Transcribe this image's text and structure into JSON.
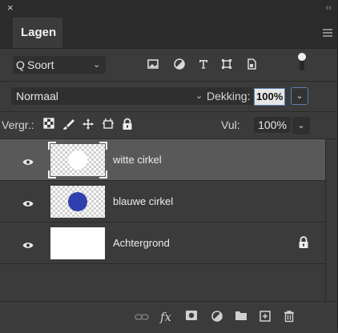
{
  "window": {
    "close_glyph": "×",
    "collapse_glyph": "‹‹"
  },
  "tabs": [
    {
      "label": "Lagen",
      "active": true
    }
  ],
  "filter": {
    "search_glyph": "Q",
    "kind_label": "Soort",
    "chevron": "⌄",
    "icons": [
      "image-filter-icon",
      "adjustment-filter-icon",
      "text-filter-icon",
      "shape-filter-icon",
      "smart-object-filter-icon"
    ]
  },
  "blend": {
    "mode": "Normaal",
    "chevron": "⌄",
    "opacity_label": "Dekking:",
    "opacity_value": "100%"
  },
  "lock": {
    "label": "Vergr.:",
    "fill_label": "Vul:",
    "fill_value": "100%"
  },
  "layers": [
    {
      "name": "witte cirkel",
      "selected": true,
      "thumb_circle_color": "#ffffff",
      "locked": false
    },
    {
      "name": "blauwe cirkel",
      "selected": false,
      "thumb_circle_color": "#2e3fae",
      "locked": false
    },
    {
      "name": "Achtergrond",
      "selected": false,
      "thumb_circle_color": null,
      "locked": true
    }
  ],
  "bottom": {
    "fx_label": "fx",
    "icons": [
      "link-layers-icon",
      "fx-icon",
      "add-mask-icon",
      "adjustment-layer-icon",
      "new-group-icon",
      "new-layer-icon",
      "delete-layer-icon"
    ]
  },
  "colors": {
    "panel_bg": "#3b3b3b",
    "selected_row": "#595959",
    "accent_border": "#5a7fb0"
  }
}
